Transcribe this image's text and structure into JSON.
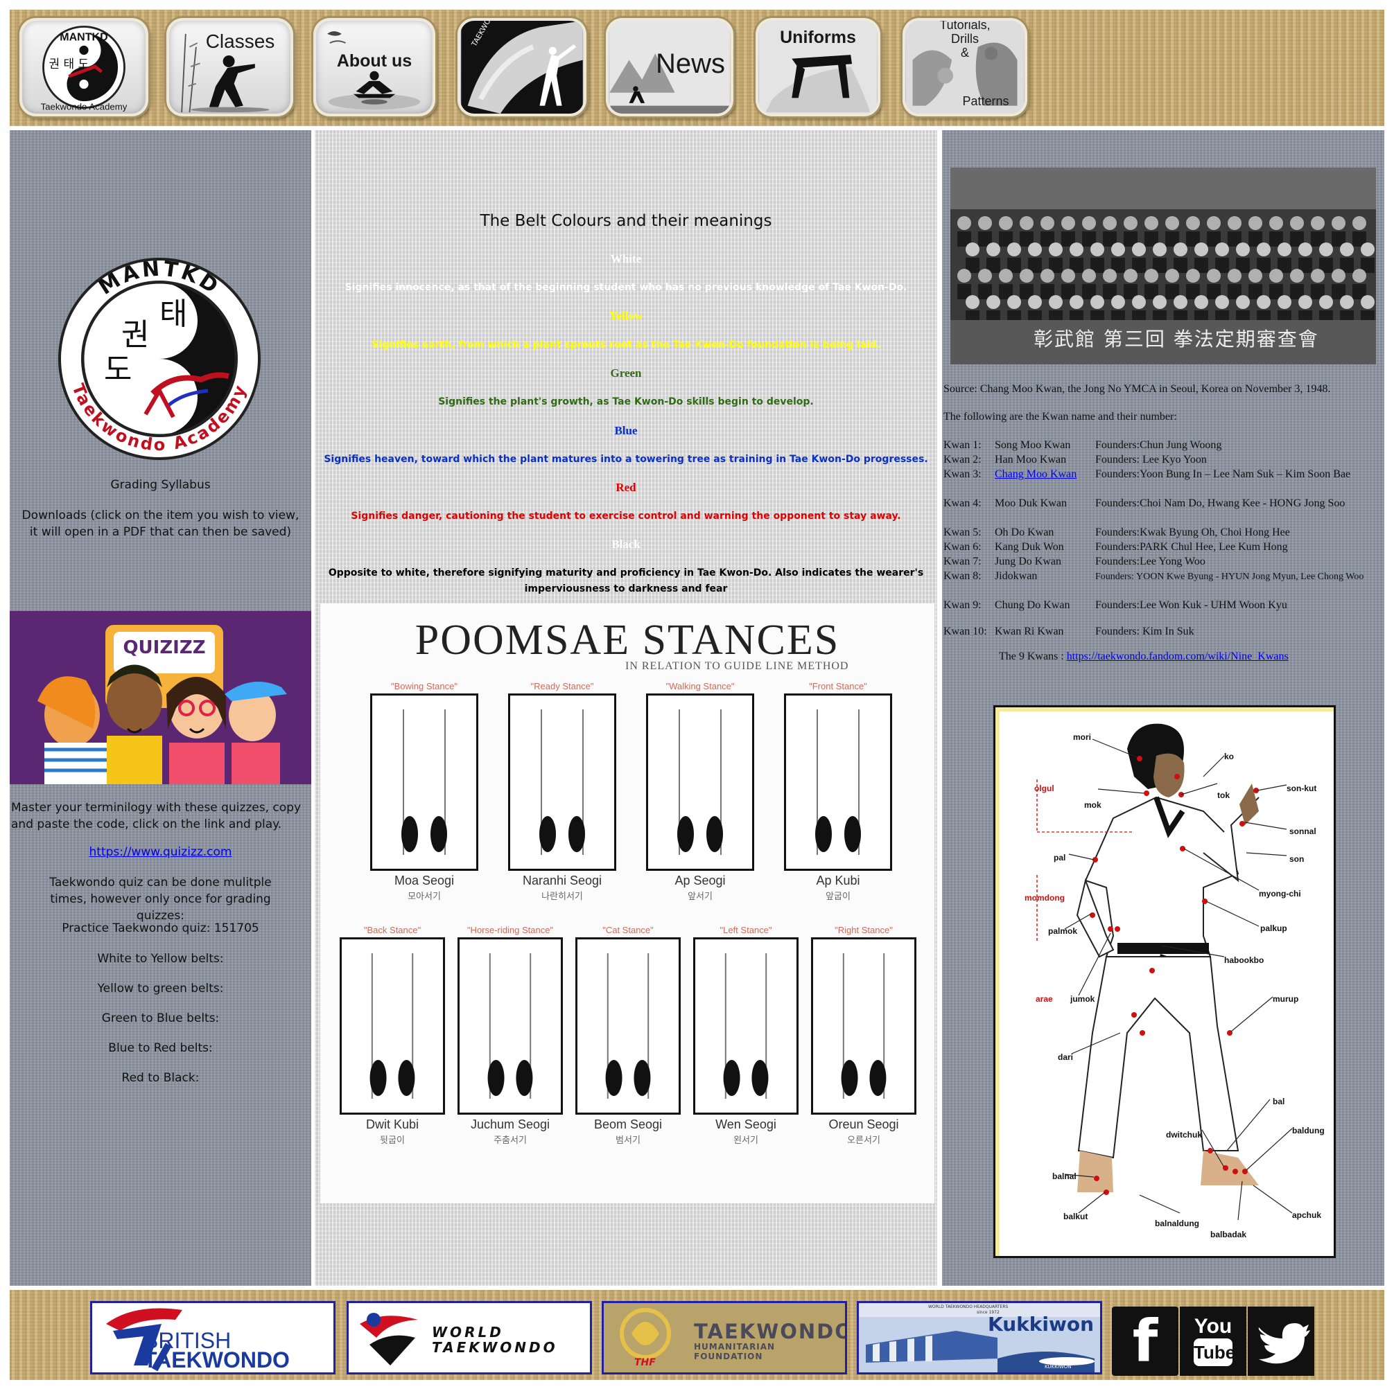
{
  "nav": {
    "items": [
      {
        "label": "",
        "logo_top": "MANTKD",
        "logo_bottom": "Taekwondo Academy",
        "hangul": "권 태 도"
      },
      {
        "label": "Classes"
      },
      {
        "label": "About us"
      },
      {
        "label": "",
        "side_text": "TAEKWONDO"
      },
      {
        "label": "News"
      },
      {
        "label": "Uniforms"
      },
      {
        "label": "Tutorials, Drills & Patterns",
        "line1": "Tutorials,",
        "line2": "Drills",
        "line3": "&",
        "line4": "Patterns"
      }
    ]
  },
  "left": {
    "logo_top": "MANTKD",
    "logo_bottom": "Taekwondo Academy",
    "logo_hangul_1": "권",
    "logo_hangul_2": "태",
    "logo_hangul_3": "도",
    "grading_syllabus": "Grading Syllabus",
    "downloads": "Downloads (click on the item you wish to view, it will open in a PDF that can then be saved)",
    "quizizz_brand": "QUIZIZZ",
    "quiz_intro": "Master your terminilogy with these quizzes, copy and paste the code, click on the link and play.",
    "quiz_link": "https://www.quizizz.com",
    "quiz_note": "Taekwondo quiz can be done mulitple times, however only once for grading quizzes:",
    "practice": "Practice Taekwondo quiz: 151705",
    "w2y": "White to Yellow belts:",
    "y2g": "Yellow to green belts:",
    "g2b": "Green to Blue belts:",
    "b2r": "Blue to Red belts:",
    "r2b": "Red to Black:"
  },
  "belts": {
    "title": "The Belt Colours and their meanings",
    "items": [
      {
        "name": "White",
        "text": "Signifies innocence, as that of the beginning student who has no previous knowledge of Tae Kwon-Do.",
        "color": "#ffffff"
      },
      {
        "name": "Yellow",
        "text": "Signifies earth, from which a plant sprouts root as the Tae Kwon-Do foundation is being laid.",
        "color": "#ffff00"
      },
      {
        "name": "Green",
        "text": "Signifies the plant's growth, as Tae Kwon-Do skills begin to develop.",
        "color": "#2e6b12"
      },
      {
        "name": "Blue",
        "text": "Signifies heaven, toward which the plant matures into a towering tree as training in Tae Kwon-Do progresses.",
        "color": "#0a2fc8"
      },
      {
        "name": "Red",
        "text": "Signifies danger, cautioning the student to exercise control and warning the opponent to stay away.",
        "color": "#e00000"
      },
      {
        "name": "Black",
        "text": "Opposite to white, therefore signifying maturity and proficiency in Tae Kwon-Do. Also indicates the wearer's imperviousness to darkness and fear",
        "name_color": "#ffffff",
        "color": "#000000"
      }
    ]
  },
  "poomsae": {
    "title": "POOMSAE STANCES",
    "subtitle": "IN RELATION TO GUIDE LINE METHOD",
    "row1": [
      {
        "tag": "\"Bowing Stance\"",
        "name": "Moa Seogi",
        "hangul": "모아서기"
      },
      {
        "tag": "\"Ready Stance\"",
        "name": "Naranhi Seogi",
        "hangul": "나란히서기"
      },
      {
        "tag": "\"Walking Stance\"",
        "name": "Ap Seogi",
        "hangul": "앞서기"
      },
      {
        "tag": "\"Front Stance\"",
        "name": "Ap Kubi",
        "hangul": "앞굽이"
      }
    ],
    "row2": [
      {
        "tag": "\"Back Stance\"",
        "name": "Dwit Kubi",
        "hangul": "뒷굽이"
      },
      {
        "tag": "\"Horse-riding Stance\"",
        "name": "Juchum Seogi",
        "hangul": "주춤서기"
      },
      {
        "tag": "\"Cat Stance\"",
        "name": "Beom Seogi",
        "hangul": "범서기"
      },
      {
        "tag": "\"Left Stance\"",
        "name": "Wen Seogi",
        "hangul": "왼서기"
      },
      {
        "tag": "\"Right Stance\"",
        "name": "Oreun Seogi",
        "hangul": "오른서기"
      }
    ]
  },
  "right": {
    "photo_caption_chars": "彰武館 第三回 拳法定期審查會",
    "source": "Source: Chang Moo Kwan, the Jong No YMCA in Seoul, Korea on November 3, 1948.",
    "following": "The following are the Kwan name and their number:",
    "kwans": [
      {
        "num": "Kwan 1:",
        "name": "Song Moo Kwan",
        "founders": "Founders:Chun Jung Woong"
      },
      {
        "num": "Kwan 2:",
        "name": "Han Moo Kwan",
        "founders": "Founders: Lee Kyo Yoon"
      },
      {
        "num": "Kwan 3:",
        "name": "Chang Moo Kwan",
        "founders": "Founders:Yoon Bung In – Lee Nam Suk – Kim Soon Bae"
      },
      {
        "num": "Kwan 4:",
        "name": "Moo Duk Kwan",
        "founders": "Founders:Choi Nam Do,  Hwang Kee - HONG Jong Soo"
      },
      {
        "num": "Kwan 5:",
        "name": "Oh Do Kwan",
        "founders": "Founders:Kwak Byung Oh,  Choi Hong Hee"
      },
      {
        "num": "Kwan 6:",
        "name": "Kang Duk Won",
        "founders": "Founders:PARK Chul Hee, Lee Kum Hong"
      },
      {
        "num": "Kwan 7:",
        "name": "Jung Do Kwan",
        "founders": "Founders:Lee Yong Woo"
      },
      {
        "num": "Kwan 8:",
        "name": "Jidokwan",
        "founders": "Founders: YOON Kwe Byung - HYUN Jong Myun,  Lee Chong Woo"
      },
      {
        "num": "Kwan 9:",
        "name": "Chung Do Kwan",
        "founders": "Founders:Lee Won Kuk - UHM Woon Kyu"
      },
      {
        "num": "Kwan 10:",
        "name": "Kwan Ri Kwan",
        "founders": "Founders: Kim In Suk"
      }
    ],
    "nine_kwans_label": "The 9 Kwans :",
    "nine_kwans_link": "https://taekwondo.fandom.com/wiki/Nine_Kwans",
    "body_labels": {
      "mori": "mori",
      "ko": "ko",
      "olgul": "olgul",
      "mok": "mok",
      "tok": "tok",
      "sonkut": "son-kut",
      "sonnal": "sonnal",
      "pal": "pal",
      "son": "son",
      "myongchi": "myong-chi",
      "momdong": "momdong",
      "palkup": "palkup",
      "palmok": "palmok",
      "habookbo": "habookbo",
      "jumok": "jumok",
      "arae": "arae",
      "murup": "murup",
      "dari": "dari",
      "bal": "bal",
      "dwitchuk": "dwitchuk",
      "baldung": "baldung",
      "balnal": "balnal",
      "balkut": "balkut",
      "balnaldung": "balnaldung",
      "balbadak": "balbadak",
      "apchuk": "apchuk"
    }
  },
  "footer": {
    "british1": "BRITISH",
    "british2": "TAEKWONDO",
    "world1": "WORLD",
    "world2": "TAEKWONDO",
    "thf1": "TAEKWONDO",
    "thf2": "HUMANITARIAN FOUNDATION",
    "thf3": "THF",
    "kuk_top": "WORLD TAEKWONDO HEADQUARTERS",
    "kuk_since": "since 1972",
    "kuk": "Kukkiwon",
    "kuk_small": "KUKKIWON",
    "fb": "f",
    "yt1": "You",
    "yt2": "Tube"
  },
  "colors": {
    "wood": "#cdb27a",
    "panel_grey": "#8e96a3",
    "quizizz_purple": "#5b2672",
    "link": "#0000ee"
  }
}
